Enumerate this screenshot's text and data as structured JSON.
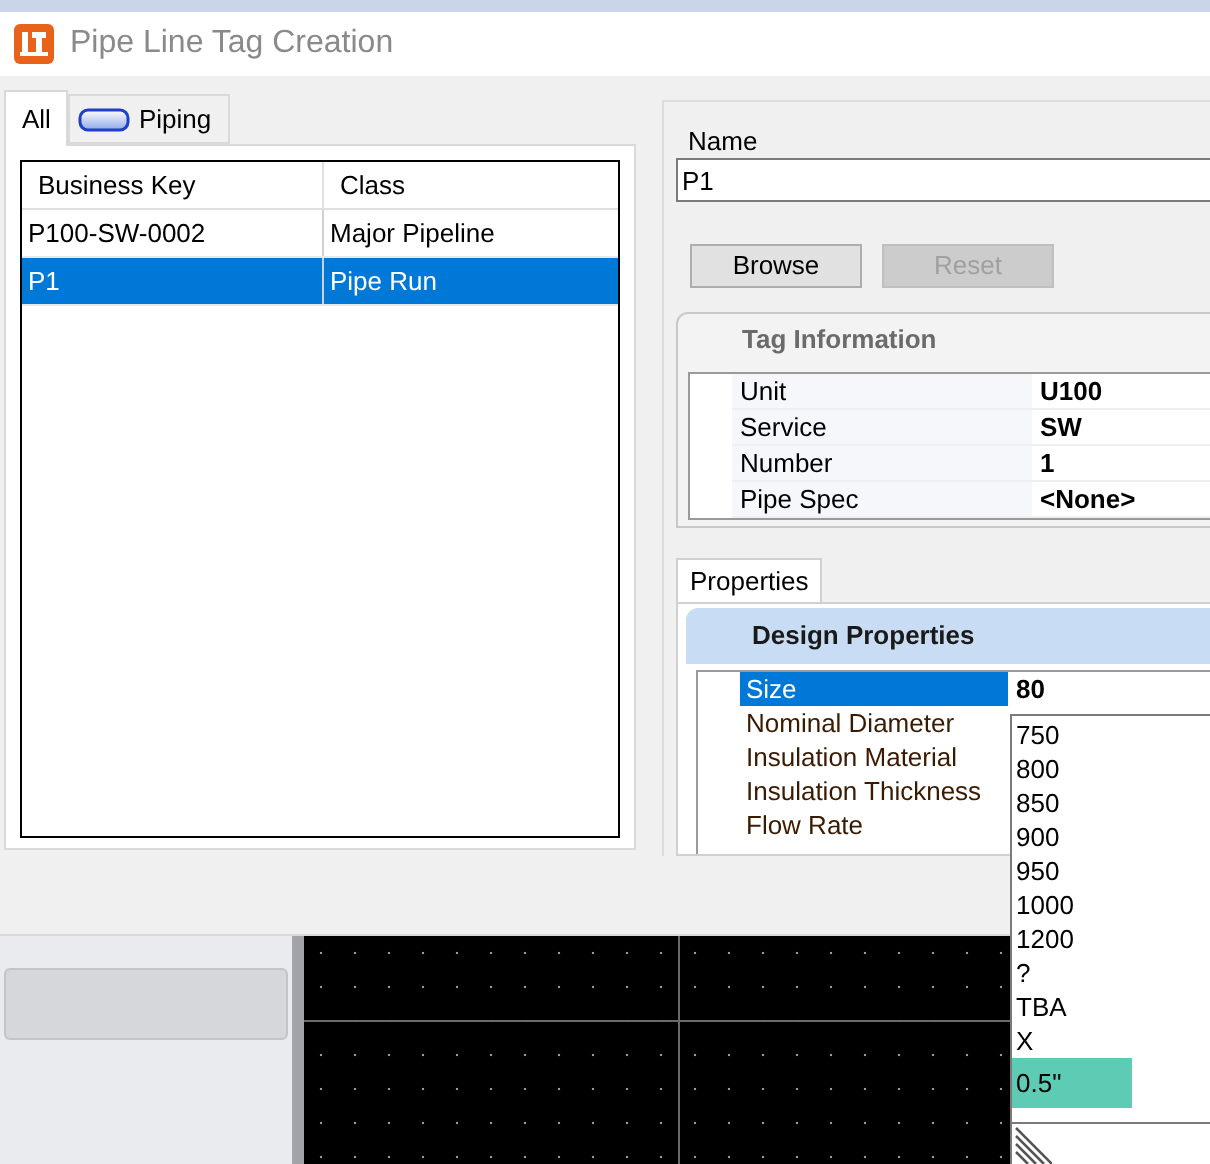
{
  "window": {
    "title": "Pipe Line Tag Creation"
  },
  "tabs": [
    {
      "label": "All",
      "kind": "plain",
      "selected": true
    },
    {
      "label": "Piping",
      "kind": "pipe",
      "selected": false
    }
  ],
  "table": {
    "columns": [
      "Business Key",
      "Class"
    ],
    "rows": [
      {
        "cells": [
          "P100-SW-0002",
          "Major Pipeline"
        ],
        "selected": false
      },
      {
        "cells": [
          "P1",
          "Pipe Run"
        ],
        "selected": true
      }
    ]
  },
  "name_field": {
    "label": "Name",
    "value": "P1"
  },
  "buttons": [
    {
      "label": "Browse",
      "disabled": false
    },
    {
      "label": "Reset",
      "disabled": true
    }
  ],
  "tag_information": {
    "title": "Tag Information",
    "rows": [
      {
        "label": "Unit",
        "value": "U100"
      },
      {
        "label": "Service",
        "value": "SW"
      },
      {
        "label": "Number",
        "value": "1"
      },
      {
        "label": "Pipe Spec",
        "value": "<None>"
      }
    ]
  },
  "properties_tab": {
    "label": "Properties",
    "selected": true
  },
  "design_properties": {
    "title": "Design Properties",
    "rows": [
      {
        "label": "Size",
        "value": "80",
        "selected": true
      },
      {
        "label": "Nominal Diameter",
        "selected": false
      },
      {
        "label": "Insulation Material",
        "selected": false
      },
      {
        "label": "Insulation Thickness",
        "selected": false
      },
      {
        "label": "Flow Rate",
        "selected": false
      }
    ]
  },
  "size_dropdown": {
    "options": [
      {
        "label": "750",
        "selected": false
      },
      {
        "label": "800",
        "selected": false
      },
      {
        "label": "850",
        "selected": false
      },
      {
        "label": "900",
        "selected": false
      },
      {
        "label": "950",
        "selected": false
      },
      {
        "label": "1000",
        "selected": false
      },
      {
        "label": "1200",
        "selected": false
      },
      {
        "label": "?",
        "selected": false
      },
      {
        "label": "TBA",
        "selected": false
      },
      {
        "label": "X",
        "selected": false
      },
      {
        "label": "0.5\"",
        "selected": true
      }
    ]
  }
}
